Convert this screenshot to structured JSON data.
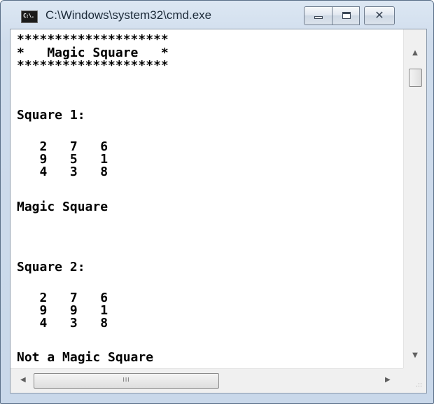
{
  "window": {
    "title": "C:\\Windows\\system32\\cmd.exe",
    "icon": "cmd-icon",
    "icon_label": "C:\\.",
    "controls": {
      "minimize": "minimize-icon",
      "maximize": "maximize-icon",
      "close": "✕"
    }
  },
  "console": {
    "lines": [
      "********************",
      "*   Magic Square   *",
      "********************",
      "",
      "Square 1:",
      "",
      "   2   7   6",
      "   9   5   1",
      "   4   3   8",
      "",
      "Magic Square",
      "",
      "",
      "",
      "Square 2:",
      "",
      "   2   7   6",
      "   9   9   1",
      "   4   3   8",
      "",
      "Not a Magic Square"
    ]
  },
  "scrollbars": {
    "up_arrow": "▲",
    "down_arrow": "▼",
    "left_arrow": "◀",
    "right_arrow": "▶",
    "thumb_grip": "III",
    "size_grip": ".::"
  }
}
